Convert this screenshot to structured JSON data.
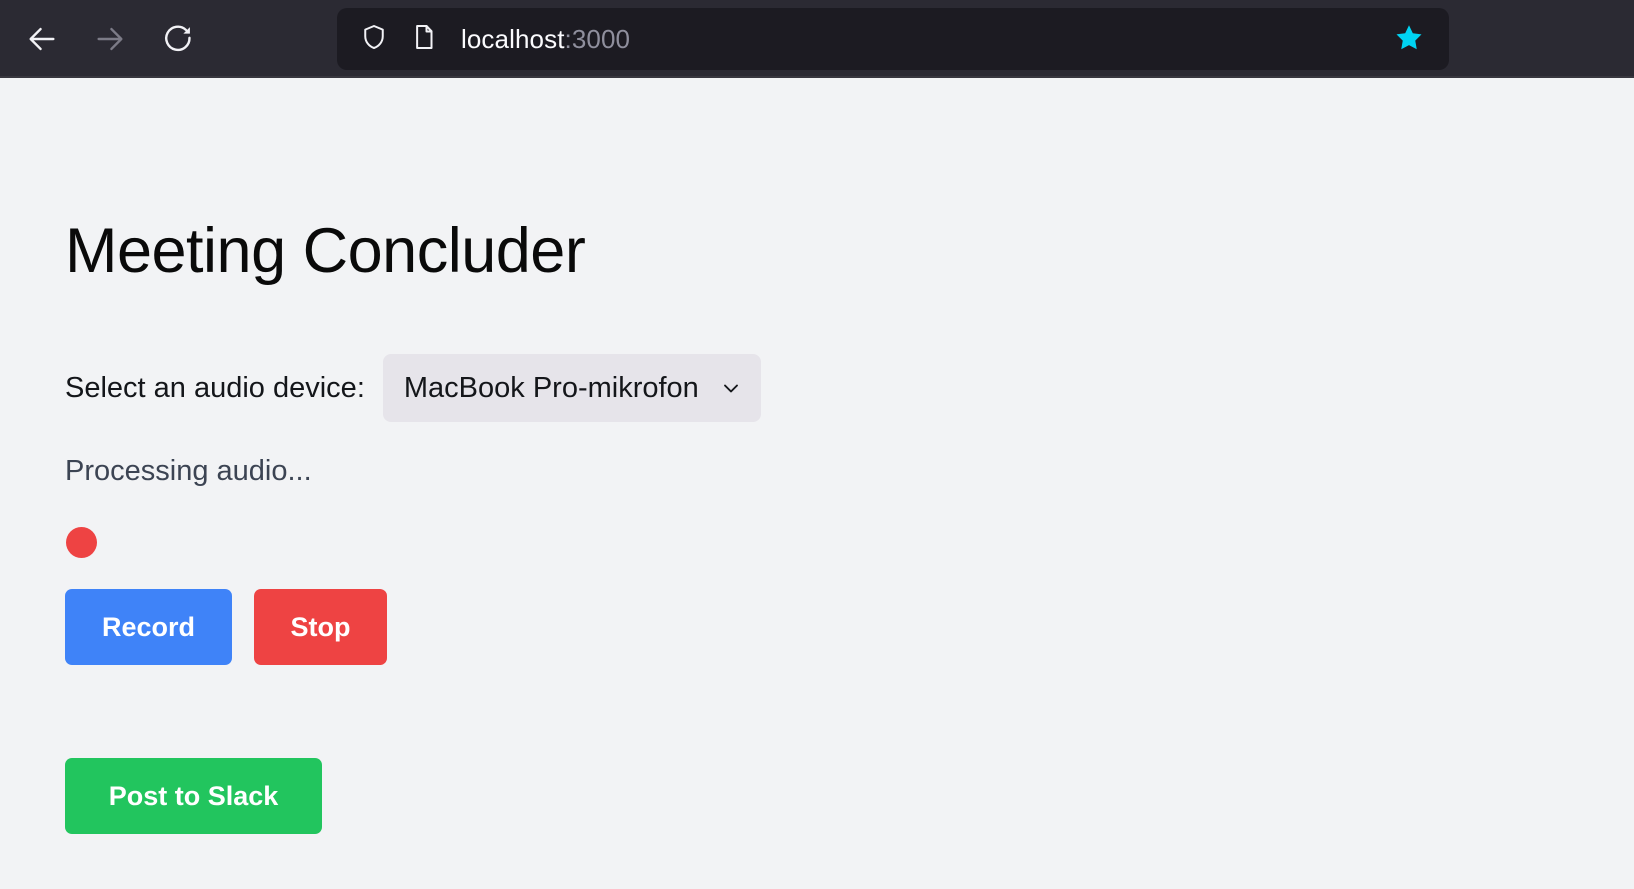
{
  "browser": {
    "back_icon": "arrow-left-icon",
    "forward_icon": "arrow-right-icon",
    "reload_icon": "reload-icon",
    "shield_icon": "shield-icon",
    "page-icon": "document-icon",
    "bookmark_icon": "star-icon",
    "url_host": "localhost",
    "url_port": ":3000",
    "colors": {
      "toolbar_bg": "#2b2a33",
      "urlbar_bg": "#1c1b22",
      "url_text": "#fbfbfe",
      "url_muted": "#8f8f9d",
      "star_fill": "#00d3f2"
    }
  },
  "page": {
    "title": "Meeting Concluder",
    "background": "#f2f3f5",
    "device": {
      "label": "Select an audio device:",
      "selected": "MacBook Pro-mikrofon",
      "options": [
        "MacBook Pro-mikrofon"
      ],
      "chevron_icon": "chevron-down-icon",
      "field_bg": "#e6e4ea"
    },
    "status": "Processing audio...",
    "recording_indicator": {
      "name": "recording-dot",
      "color": "#ee4343"
    },
    "buttons": {
      "record": "Record",
      "stop": "Stop",
      "slack": "Post to Slack"
    },
    "colors": {
      "record_bg": "#3f83f8",
      "stop_bg": "#ee4343",
      "slack_bg": "#22c55e",
      "title_color": "#0a0a0a",
      "status_color": "#3c4453"
    }
  }
}
